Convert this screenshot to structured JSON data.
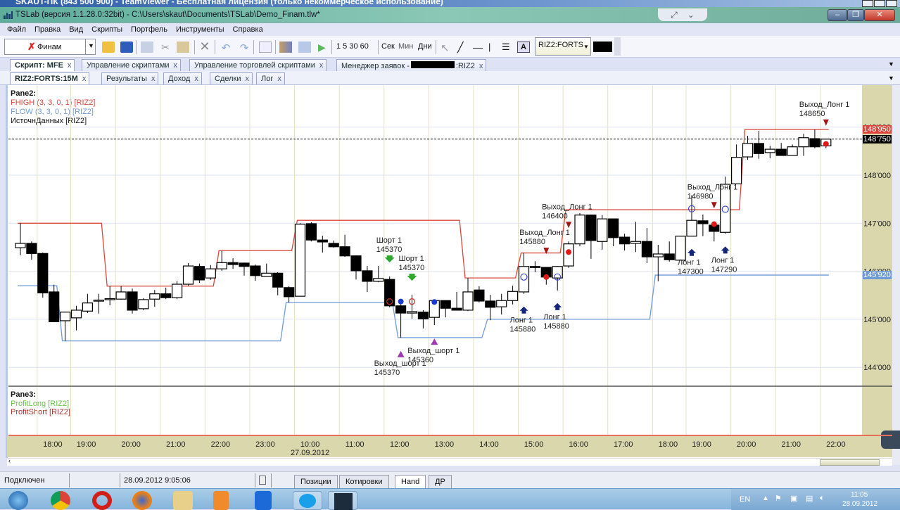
{
  "teamviewer_title": "SKAUT-ПК (843 500 900) - TeamViewer - Бесплатная лицензия (только некоммерческое использование)",
  "window_title": "TSLab (версия 1.1.28.0:32bit) - C:\\Users\\skaut\\Documents\\TSLab\\Demo_Finam.tlw*",
  "menu": [
    "Файл",
    "Правка",
    "Вид",
    "Скрипты",
    "Портфель",
    "Инструменты",
    "Справка"
  ],
  "toolbar": {
    "provider": "Финам",
    "intervals": "1 5 30 60",
    "units": [
      "Сек",
      "Мин",
      "Дни"
    ],
    "instrument": "RIZ2:FORTS",
    "icons": [
      "open-folder-icon",
      "save-icon",
      "copy-icon",
      "cut-icon",
      "paste-icon",
      "delete-icon",
      "undo-icon",
      "redo-icon",
      "properties-icon",
      "chart-icon",
      "layout-icon",
      "play-icon",
      "cursor-icon",
      "line-icon",
      "horizontal-line-icon",
      "vertical-line-icon",
      "fibonacci-icon",
      "text-icon"
    ]
  },
  "doc_tabs": [
    {
      "label": "Скрипт: MFE",
      "active": true
    },
    {
      "label": "Управление скриптами"
    },
    {
      "label": "Управление торговлей скриптами"
    },
    {
      "label": "Менеджер заявок -",
      "suffix": ":RIZ2"
    }
  ],
  "inner_tabs": [
    {
      "label": "RIZ2:FORTS:15M",
      "active": true
    },
    {
      "label": "Результаты"
    },
    {
      "label": "Доход"
    },
    {
      "label": "Сделки"
    },
    {
      "label": "Лог"
    }
  ],
  "close_glyph": "x",
  "pane2": {
    "title": "Pane2:",
    "legend": [
      {
        "label": "FHIGH (3, 3, 0, 1) [RIZ2]",
        "color": "#d9463a"
      },
      {
        "label": "FLOW (3, 3, 0, 1) [RIZ2]",
        "color": "#6f9ad8"
      },
      {
        "label": "ИсточнДанных [RIZ2]",
        "color": "#111111"
      }
    ]
  },
  "pane3": {
    "title": "Pane3:",
    "legend": [
      {
        "label": "ProfitLong [RIZ2]",
        "color": "#6cc24a"
      },
      {
        "label": "ProfitShort [RIZ2]",
        "color": "#a8322c"
      }
    ]
  },
  "chart_data": {
    "type": "candlestick",
    "instrument": "RIZ2",
    "y_ticks": [
      {
        "value": 149000,
        "label": "149'000"
      },
      {
        "value": 148000,
        "label": "148'000"
      },
      {
        "value": 147000,
        "label": "147'000"
      },
      {
        "value": 146000,
        "label": "146'000"
      },
      {
        "value": 145000,
        "label": "145'000"
      },
      {
        "value": 144000,
        "label": "144'000"
      }
    ],
    "ylim": [
      143600,
      149900
    ],
    "x_ticks": [
      {
        "bar": 2.5,
        "label": "18:00"
      },
      {
        "bar": 5.5,
        "label": "19:00"
      },
      {
        "bar": 9.5,
        "label": "20:00"
      },
      {
        "bar": 13.5,
        "label": "21:00"
      },
      {
        "bar": 17.5,
        "label": "22:00"
      },
      {
        "bar": 21.5,
        "label": "23:00"
      },
      {
        "bar": 25.5,
        "label": "10:00",
        "date": "27.09.2012"
      },
      {
        "bar": 29.5,
        "label": "11:00"
      },
      {
        "bar": 33.5,
        "label": "12:00"
      },
      {
        "bar": 37.5,
        "label": "13:00"
      },
      {
        "bar": 41.5,
        "label": "14:00"
      },
      {
        "bar": 45.5,
        "label": "15:00"
      },
      {
        "bar": 49.5,
        "label": "16:00"
      },
      {
        "bar": 53.5,
        "label": "17:00"
      },
      {
        "bar": 57.5,
        "label": "18:00"
      },
      {
        "bar": 60.5,
        "label": "19:00"
      },
      {
        "bar": 64.5,
        "label": "20:00"
      },
      {
        "bar": 68.5,
        "label": "21:00"
      },
      {
        "bar": 72.5,
        "label": "22:00"
      }
    ],
    "candles_ohlc": [
      [
        146490,
        147000,
        146330,
        146580
      ],
      [
        146580,
        146620,
        146240,
        146370
      ],
      [
        146370,
        146390,
        145450,
        145550
      ],
      [
        145570,
        145720,
        144940,
        144950
      ],
      [
        144970,
        145160,
        144550,
        145150
      ],
      [
        145030,
        145280,
        144770,
        145190
      ],
      [
        145170,
        145530,
        145130,
        145340
      ],
      [
        145390,
        145530,
        145120,
        145400
      ],
      [
        145410,
        145690,
        145290,
        145430
      ],
      [
        145420,
        145690,
        145410,
        145570
      ],
      [
        145570,
        145640,
        145120,
        145190
      ],
      [
        145220,
        145440,
        145190,
        145410
      ],
      [
        145420,
        145610,
        145260,
        145530
      ],
      [
        145530,
        145660,
        145420,
        145450
      ],
      [
        145450,
        145800,
        145420,
        145730
      ],
      [
        145730,
        146170,
        145700,
        146110
      ],
      [
        146100,
        146160,
        145760,
        145820
      ],
      [
        145860,
        146130,
        145820,
        146050
      ],
      [
        146050,
        146420,
        146010,
        146180
      ],
      [
        146180,
        146270,
        146050,
        146140
      ],
      [
        146170,
        146180,
        145910,
        146100
      ],
      [
        146110,
        146140,
        145800,
        145910
      ],
      [
        145890,
        146160,
        145890,
        145960
      ],
      [
        145960,
        145980,
        145500,
        145670
      ],
      [
        145660,
        145690,
        145350,
        145470
      ],
      [
        145480,
        147000,
        145480,
        146980
      ],
      [
        146990,
        147020,
        146620,
        146650
      ],
      [
        146650,
        146740,
        146390,
        146610
      ],
      [
        146580,
        146640,
        146490,
        146510
      ],
      [
        146510,
        146760,
        146300,
        146320
      ],
      [
        146320,
        146330,
        145830,
        146010
      ],
      [
        146010,
        146110,
        145570,
        145790
      ],
      [
        145790,
        146110,
        145770,
        145850
      ],
      [
        145830,
        145890,
        145250,
        145280
      ],
      [
        145280,
        145310,
        144620,
        145130
      ],
      [
        145130,
        145510,
        145010,
        145160
      ],
      [
        145150,
        145190,
        144810,
        145010
      ],
      [
        145040,
        145410,
        144880,
        145390
      ],
      [
        145390,
        145390,
        145040,
        145230
      ],
      [
        145230,
        145570,
        145190,
        145190
      ],
      [
        145190,
        145860,
        145170,
        145570
      ],
      [
        145610,
        145690,
        145350,
        145380
      ],
      [
        145380,
        145510,
        144980,
        145250
      ],
      [
        145260,
        145530,
        145100,
        145390
      ],
      [
        145390,
        145700,
        145310,
        145580
      ],
      [
        145570,
        146380,
        145530,
        146100
      ],
      [
        146100,
        146210,
        145980,
        146080
      ],
      [
        146080,
        146080,
        145720,
        145880
      ],
      [
        145860,
        146110,
        145600,
        146100
      ],
      [
        146110,
        146620,
        146070,
        146570
      ],
      [
        146570,
        147210,
        146520,
        147170
      ],
      [
        147170,
        147180,
        146260,
        146640
      ],
      [
        146620,
        147170,
        146450,
        147090
      ],
      [
        147090,
        147090,
        146520,
        146700
      ],
      [
        146710,
        146780,
        146430,
        146570
      ],
      [
        146580,
        147030,
        146400,
        146620
      ],
      [
        146620,
        146900,
        146170,
        146300
      ],
      [
        146300,
        146550,
        145790,
        146360
      ],
      [
        146360,
        146620,
        146200,
        146240
      ],
      [
        146230,
        146730,
        146230,
        146730
      ],
      [
        146730,
        147580,
        146730,
        147060
      ],
      [
        147050,
        147180,
        146730,
        146990
      ],
      [
        146960,
        147030,
        146620,
        146830
      ],
      [
        146810,
        147970,
        146780,
        147810
      ],
      [
        147820,
        148640,
        147820,
        148370
      ],
      [
        148380,
        148820,
        148320,
        148660
      ],
      [
        148660,
        148920,
        148340,
        148450
      ],
      [
        148470,
        148610,
        148350,
        148540
      ],
      [
        148540,
        148670,
        148410,
        148410
      ],
      [
        148410,
        148640,
        148410,
        148590
      ],
      [
        148590,
        148860,
        148400,
        148780
      ],
      [
        148760,
        148950,
        148560,
        148590
      ],
      [
        148610,
        148750,
        148560,
        148750
      ]
    ],
    "fhigh_steps": [
      {
        "from": 1,
        "to": 8,
        "value": 147000
      },
      {
        "from": 9,
        "to": 18,
        "value": 145690
      },
      {
        "from": 19,
        "to": 25,
        "value": 146430
      },
      {
        "from": 26,
        "to": 40,
        "value": 147060
      },
      {
        "from": 41,
        "to": 45,
        "value": 145860
      },
      {
        "from": 46,
        "to": 49,
        "value": 146380
      },
      {
        "from": 50,
        "to": 65,
        "value": 147280
      },
      {
        "from": 66,
        "to": 73,
        "value": 148950
      }
    ],
    "flow_steps": [
      {
        "from": 1,
        "to": 4,
        "value": 145700
      },
      {
        "from": 5,
        "to": 24,
        "value": 144550
      },
      {
        "from": 25,
        "to": 34,
        "value": 145350
      },
      {
        "from": 35,
        "to": 42,
        "value": 144620
      },
      {
        "from": 43,
        "to": 57,
        "value": 145000
      },
      {
        "from": 58,
        "to": 73,
        "value": 145920
      }
    ],
    "last_price": {
      "value": 148750,
      "label": "148'750"
    },
    "fhigh_last": {
      "value": 148950,
      "label": "148'950",
      "color": "#d9463a"
    },
    "flow_last": {
      "value": 145920,
      "label": "145'920",
      "color": "#6f9ad8"
    },
    "signals": [
      {
        "type": "short_entry",
        "name": "Шорт 1",
        "price": "145370",
        "bar": 34
      },
      {
        "type": "short_entry",
        "name": "Шорт 1",
        "price": "145370",
        "bar": 36
      },
      {
        "type": "short_exit",
        "name": "Выход_шорт 1",
        "price": "145370",
        "bar": 35
      },
      {
        "type": "short_exit",
        "name": "Выход_шорт 1",
        "price": "145360",
        "bar": 38
      },
      {
        "type": "long_entry",
        "name": "Лонг 1",
        "price": "145880",
        "bar": 46
      },
      {
        "type": "long_entry",
        "name": "Лонг 1",
        "price": "145880",
        "bar": 49
      },
      {
        "type": "long_exit",
        "name": "Выход_Лонг 1",
        "price": "145880",
        "bar": 48
      },
      {
        "type": "long_exit",
        "name": "Выход_Лонг 1",
        "price": "146400",
        "bar": 50
      },
      {
        "type": "long_entry",
        "name": "Лонг 1",
        "price": "147300",
        "bar": 61
      },
      {
        "type": "long_entry",
        "name": "Лонг 1",
        "price": "147290",
        "bar": 64
      },
      {
        "type": "long_exit",
        "name": "Выход_Лонг 1",
        "price": "146980",
        "bar": 63
      },
      {
        "type": "long_exit",
        "name": "Выход_Лонг 1",
        "price": "148650",
        "bar": 73
      }
    ],
    "colors": {
      "up": "#ffffff",
      "down": "#000000",
      "fhigh": "#d9463a",
      "flow": "#6f9ad8",
      "short_arrow": "#2fa82f",
      "long_arrow": "#14257a",
      "exit_short": "#9a3cb0",
      "exit_long": "#a01818"
    }
  },
  "status": {
    "connection": "Подключен",
    "datetime": "28.09.2012 9:05:06",
    "tabs": [
      {
        "label": "Позиции"
      },
      {
        "label": "Котировки"
      },
      {
        "label": "Hand",
        "active": true
      },
      {
        "label": "ДР"
      }
    ]
  },
  "taskbar": {
    "apps": [
      "windows-start",
      "chrome",
      "opera",
      "firefox",
      "explorer",
      "media-player",
      "teamviewer",
      "skype",
      "tslab"
    ],
    "lang": "EN",
    "time": "11:05",
    "date": "28.09.2012"
  }
}
